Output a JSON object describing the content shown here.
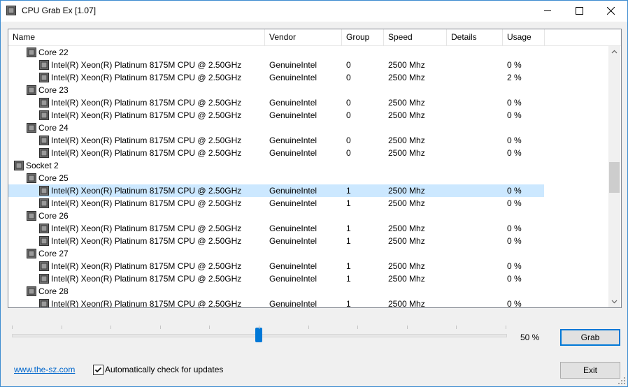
{
  "window": {
    "title": "CPU Grab Ex [1.07]",
    "icons": {
      "app": "cpu-chip-icon",
      "minimize": "minimize-icon",
      "maximize": "maximize-icon",
      "close": "close-icon"
    }
  },
  "table": {
    "columns": [
      "Name",
      "Vendor",
      "Group",
      "Speed",
      "Details",
      "Usage"
    ],
    "rows": [
      {
        "level": 1,
        "name": "Core 22",
        "vendor": "",
        "group": "",
        "speed": "",
        "details": "",
        "usage": ""
      },
      {
        "level": 2,
        "name": "Intel(R) Xeon(R) Platinum 8175M CPU @ 2.50GHz",
        "vendor": "GenuineIntel",
        "group": "0",
        "speed": "2500 Mhz",
        "details": "",
        "usage": "0 %"
      },
      {
        "level": 2,
        "name": "Intel(R) Xeon(R) Platinum 8175M CPU @ 2.50GHz",
        "vendor": "GenuineIntel",
        "group": "0",
        "speed": "2500 Mhz",
        "details": "",
        "usage": "2 %"
      },
      {
        "level": 1,
        "name": "Core 23",
        "vendor": "",
        "group": "",
        "speed": "",
        "details": "",
        "usage": ""
      },
      {
        "level": 2,
        "name": "Intel(R) Xeon(R) Platinum 8175M CPU @ 2.50GHz",
        "vendor": "GenuineIntel",
        "group": "0",
        "speed": "2500 Mhz",
        "details": "",
        "usage": "0 %"
      },
      {
        "level": 2,
        "name": "Intel(R) Xeon(R) Platinum 8175M CPU @ 2.50GHz",
        "vendor": "GenuineIntel",
        "group": "0",
        "speed": "2500 Mhz",
        "details": "",
        "usage": "0 %"
      },
      {
        "level": 1,
        "name": "Core 24",
        "vendor": "",
        "group": "",
        "speed": "",
        "details": "",
        "usage": ""
      },
      {
        "level": 2,
        "name": "Intel(R) Xeon(R) Platinum 8175M CPU @ 2.50GHz",
        "vendor": "GenuineIntel",
        "group": "0",
        "speed": "2500 Mhz",
        "details": "",
        "usage": "0 %"
      },
      {
        "level": 2,
        "name": "Intel(R) Xeon(R) Platinum 8175M CPU @ 2.50GHz",
        "vendor": "GenuineIntel",
        "group": "0",
        "speed": "2500 Mhz",
        "details": "",
        "usage": "0 %"
      },
      {
        "level": 0,
        "name": "Socket 2",
        "vendor": "",
        "group": "",
        "speed": "",
        "details": "",
        "usage": ""
      },
      {
        "level": 1,
        "name": "Core 25",
        "vendor": "",
        "group": "",
        "speed": "",
        "details": "",
        "usage": ""
      },
      {
        "level": 2,
        "name": "Intel(R) Xeon(R) Platinum 8175M CPU @ 2.50GHz",
        "vendor": "GenuineIntel",
        "group": "1",
        "speed": "2500 Mhz",
        "details": "",
        "usage": "0 %",
        "selected": true
      },
      {
        "level": 2,
        "name": "Intel(R) Xeon(R) Platinum 8175M CPU @ 2.50GHz",
        "vendor": "GenuineIntel",
        "group": "1",
        "speed": "2500 Mhz",
        "details": "",
        "usage": "0 %"
      },
      {
        "level": 1,
        "name": "Core 26",
        "vendor": "",
        "group": "",
        "speed": "",
        "details": "",
        "usage": ""
      },
      {
        "level": 2,
        "name": "Intel(R) Xeon(R) Platinum 8175M CPU @ 2.50GHz",
        "vendor": "GenuineIntel",
        "group": "1",
        "speed": "2500 Mhz",
        "details": "",
        "usage": "0 %"
      },
      {
        "level": 2,
        "name": "Intel(R) Xeon(R) Platinum 8175M CPU @ 2.50GHz",
        "vendor": "GenuineIntel",
        "group": "1",
        "speed": "2500 Mhz",
        "details": "",
        "usage": "0 %"
      },
      {
        "level": 1,
        "name": "Core 27",
        "vendor": "",
        "group": "",
        "speed": "",
        "details": "",
        "usage": ""
      },
      {
        "level": 2,
        "name": "Intel(R) Xeon(R) Platinum 8175M CPU @ 2.50GHz",
        "vendor": "GenuineIntel",
        "group": "1",
        "speed": "2500 Mhz",
        "details": "",
        "usage": "0 %"
      },
      {
        "level": 2,
        "name": "Intel(R) Xeon(R) Platinum 8175M CPU @ 2.50GHz",
        "vendor": "GenuineIntel",
        "group": "1",
        "speed": "2500 Mhz",
        "details": "",
        "usage": "0 %"
      },
      {
        "level": 1,
        "name": "Core 28",
        "vendor": "",
        "group": "",
        "speed": "",
        "details": "",
        "usage": ""
      },
      {
        "level": 2,
        "name": "Intel(R) Xeon(R) Platinum 8175M CPU @ 2.50GHz",
        "vendor": "GenuineIntel",
        "group": "1",
        "speed": "2500 Mhz",
        "details": "",
        "usage": "0 %"
      }
    ]
  },
  "controls": {
    "slider_value_fraction": 0.5,
    "slider_label": "50 %",
    "grab_label": "Grab",
    "exit_label": "Exit",
    "link_text": "www.the-sz.com",
    "auto_update_label": "Automatically check for updates",
    "auto_update_checked": true
  },
  "colors": {
    "selection": "#cce8ff",
    "accent": "#0078d7",
    "link": "#0066cc"
  }
}
